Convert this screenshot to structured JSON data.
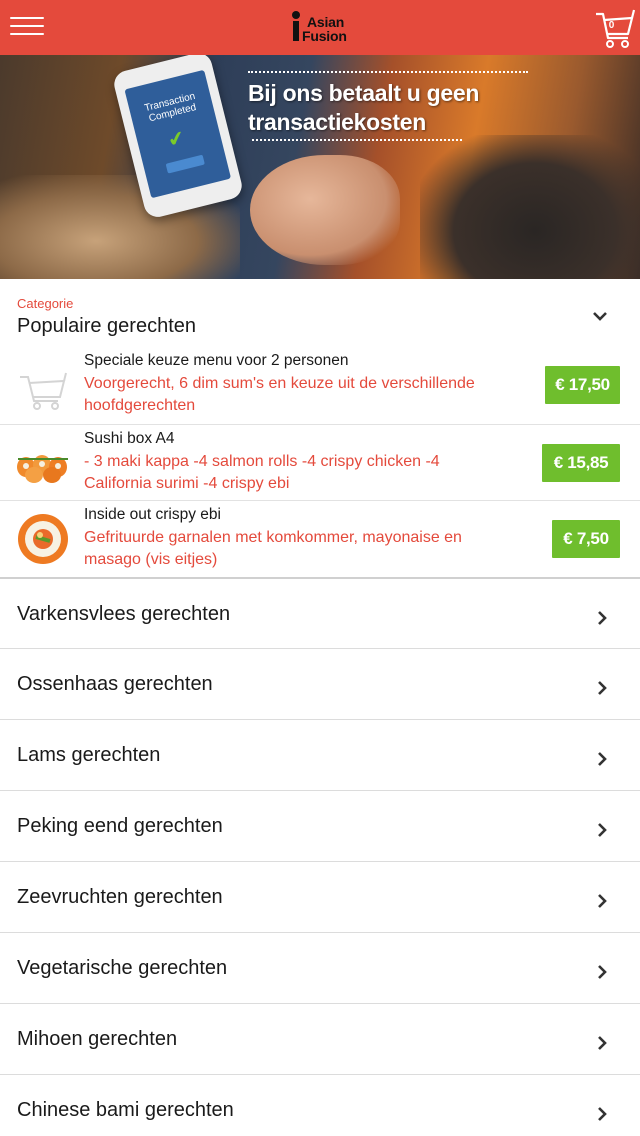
{
  "header": {
    "logo_line1": "Asian",
    "logo_line2": "Fusion",
    "cart_count": "0",
    "brand_color": "#e44a3c"
  },
  "banner": {
    "headline": "Bij ons betaalt u geen transactiekosten",
    "phone_text": "Transaction Completed"
  },
  "category": {
    "label": "Categorie",
    "selected": "Populaire gerechten"
  },
  "products": [
    {
      "name": "Speciale keuze menu voor 2 personen",
      "description": "Voorgerecht, 6 dim sum's en keuze uit de verschillende hoofdgerechten",
      "price": "€ 17,50",
      "thumb": "cart-icon"
    },
    {
      "name": "Sushi box A4",
      "description": "- 3 maki kappa  -4 salmon rolls  -4 crispy chicken  -4 California surimi  -4 crispy ebi",
      "price": "€ 15,85",
      "thumb": "sushi-box-image"
    },
    {
      "name": "Inside out crispy ebi",
      "description": "Gefrituurde garnalen met komkommer, mayonaise en masago (vis eitjes)",
      "price": "€ 7,50",
      "thumb": "sushi-roll-image"
    }
  ],
  "menu": [
    {
      "label": "Varkensvlees gerechten"
    },
    {
      "label": "Ossenhaas gerechten"
    },
    {
      "label": "Lams gerechten"
    },
    {
      "label": "Peking eend gerechten"
    },
    {
      "label": "Zeevruchten gerechten"
    },
    {
      "label": "Vegetarische gerechten"
    },
    {
      "label": "Mihoen gerechten"
    },
    {
      "label": "Chinese bami gerechten"
    }
  ],
  "colors": {
    "accent": "#e44a3c",
    "price_green": "#6fbe2d"
  }
}
